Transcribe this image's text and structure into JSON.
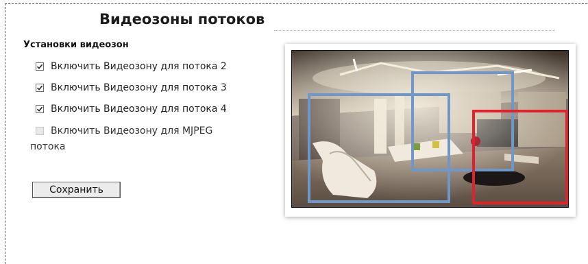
{
  "page": {
    "title": "Видеозоны потоков",
    "section_title": "Установки видеозон"
  },
  "options": [
    {
      "label": "Включить Видеозону для потока 2",
      "checked": true,
      "enabled": true
    },
    {
      "label": "Включить Видеозону для потока 3",
      "checked": true,
      "enabled": true
    },
    {
      "label": "Включить Видеозону для потока 4",
      "checked": true,
      "enabled": true
    },
    {
      "label_line1": "Включить Видеозону для MJPEG",
      "label_line2": "потока",
      "checked": false,
      "enabled": false
    }
  ],
  "save_button": {
    "label": "Сохранить"
  },
  "preview": {
    "zones": [
      {
        "name": "zone-stream-2",
        "color": "#6f98c9"
      },
      {
        "name": "zone-stream-3",
        "color": "#6f98c9"
      },
      {
        "name": "zone-stream-4",
        "color": "#e0232a"
      }
    ]
  }
}
